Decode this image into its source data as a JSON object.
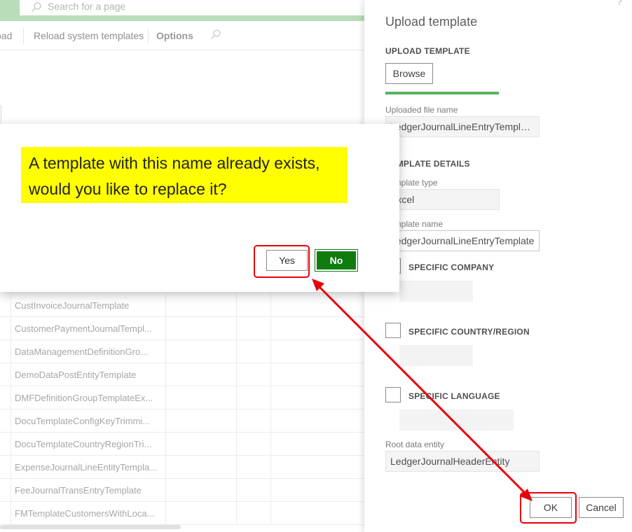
{
  "header": {
    "search_placeholder": "Search for a page"
  },
  "action_bar": {
    "load_label": "oad",
    "reload_label": "Reload system templates",
    "options_label": "Options"
  },
  "grid": {
    "rows": [
      "CustInvoiceJournalTemplate",
      "CustomerPaymentJournalTempl...",
      "DataManagementDefinitionGro...",
      "DemoDataPostEntityTemplate",
      "DMFDefinitionGroupTemplateEx...",
      "DocuTemplateConfigKeyTrimmi...",
      "DocuTemplateCountryRegionTri...",
      "ExpenseJournalLineEntityTempla...",
      "FeeJournalTransEntryTemplate",
      "FMTemplateCustomersWithLoca..."
    ]
  },
  "dialog": {
    "message": "A template with this name already exists, would you like to replace it?",
    "yes_label": "Yes",
    "no_label": "No"
  },
  "panel": {
    "help": "?",
    "title": "Upload template",
    "upload_section": "UPLOAD TEMPLATE",
    "browse_label": "Browse",
    "upload_progress": 1.0,
    "uploaded_file_label": "Uploaded file name",
    "uploaded_file_value": "LedgerJournalLineEntryTemplat...",
    "details_section": "TEMPLATE DETAILS",
    "template_type_label": "Template type",
    "template_type_value": "Excel",
    "template_name_label": "Template name",
    "template_name_value": "LedgerJournalLineEntryTemplate",
    "specific_company_label": "SPECIFIC COMPANY",
    "specific_country_label": "SPECIFIC COUNTRY/REGION",
    "specific_language_label": "SPECIFIC LANGUAGE",
    "root_entity_label": "Root data entity",
    "root_entity_value": "LedgerJournalHeaderEntity",
    "ok_label": "OK",
    "cancel_label": "Cancel"
  },
  "colors": {
    "primary_button": "#107c10",
    "highlight": "#ffff00",
    "annotation": "#e8000b",
    "progress": "#59b35f"
  }
}
